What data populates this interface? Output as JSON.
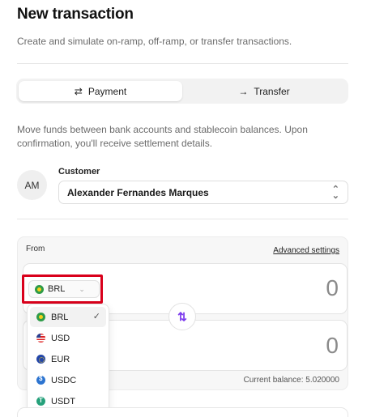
{
  "header": {
    "title": "New transaction",
    "subtitle": "Create and simulate on-ramp, off-ramp, or transfer transactions."
  },
  "tabs": [
    {
      "label": "Payment",
      "icon": "arrows-exchange-icon",
      "active": true
    },
    {
      "label": "Transfer",
      "icon": "arrow-right-icon",
      "active": false
    }
  ],
  "description": "Move funds between bank accounts and stablecoin balances. Upon confirmation, you'll receive settlement details.",
  "customer": {
    "label": "Customer",
    "initials": "AM",
    "value": "Alexander Fernandes Marques"
  },
  "from_section": {
    "label": "From",
    "advanced_settings": "Advanced settings",
    "source": {
      "currency": "BRL",
      "amount": "0"
    },
    "destination": {
      "amount": "0"
    },
    "balance_text": "Current balance: 5.020000"
  },
  "currency_dropdown": {
    "options": [
      {
        "code": "BRL",
        "icon": "brazil-flag-icon",
        "selected": true
      },
      {
        "code": "USD",
        "icon": "us-flag-icon",
        "selected": false
      },
      {
        "code": "EUR",
        "icon": "eu-flag-icon",
        "selected": false
      },
      {
        "code": "USDC",
        "icon": "usdc-coin-icon",
        "selected": false
      },
      {
        "code": "USDT",
        "icon": "usdt-coin-icon",
        "selected": false
      }
    ]
  },
  "colors": {
    "accent": "#7c3aed",
    "highlight": "#d9001b"
  }
}
